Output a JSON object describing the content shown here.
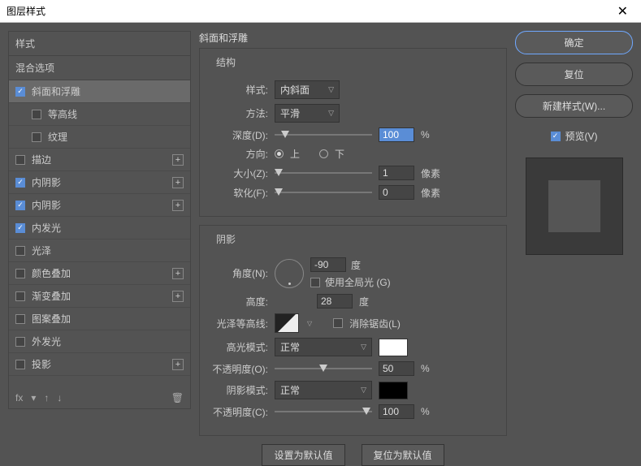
{
  "window": {
    "title": "图层样式"
  },
  "sidebar": {
    "header": "样式",
    "blend": "混合选项",
    "items": [
      {
        "label": "斜面和浮雕",
        "checked": true,
        "selected": true,
        "plus": false,
        "indent": false
      },
      {
        "label": "等高线",
        "checked": false,
        "selected": false,
        "plus": false,
        "indent": true
      },
      {
        "label": "纹理",
        "checked": false,
        "selected": false,
        "plus": false,
        "indent": true
      },
      {
        "label": "描边",
        "checked": false,
        "selected": false,
        "plus": true,
        "indent": false
      },
      {
        "label": "内阴影",
        "checked": true,
        "selected": false,
        "plus": true,
        "indent": false
      },
      {
        "label": "内阴影",
        "checked": true,
        "selected": false,
        "plus": true,
        "indent": false
      },
      {
        "label": "内发光",
        "checked": true,
        "selected": false,
        "plus": false,
        "indent": false
      },
      {
        "label": "光泽",
        "checked": false,
        "selected": false,
        "plus": false,
        "indent": false
      },
      {
        "label": "颜色叠加",
        "checked": false,
        "selected": false,
        "plus": true,
        "indent": false
      },
      {
        "label": "渐变叠加",
        "checked": false,
        "selected": false,
        "plus": true,
        "indent": false
      },
      {
        "label": "图案叠加",
        "checked": false,
        "selected": false,
        "plus": false,
        "indent": false
      },
      {
        "label": "外发光",
        "checked": false,
        "selected": false,
        "plus": false,
        "indent": false
      },
      {
        "label": "投影",
        "checked": false,
        "selected": false,
        "plus": true,
        "indent": false
      }
    ],
    "footer": {
      "fx": "fx"
    }
  },
  "panel": {
    "title": "斜面和浮雕",
    "structure": {
      "title": "结构",
      "style_lbl": "样式:",
      "style_val": "内斜面",
      "method_lbl": "方法:",
      "method_val": "平滑",
      "depth_lbl": "深度(D):",
      "depth_val": "100",
      "depth_unit": "%",
      "dir_lbl": "方向:",
      "dir_up": "上",
      "dir_down": "下",
      "size_lbl": "大小(Z):",
      "size_val": "1",
      "size_unit": "像素",
      "soften_lbl": "软化(F):",
      "soften_val": "0",
      "soften_unit": "像素"
    },
    "shading": {
      "title": "阴影",
      "angle_lbl": "角度(N):",
      "angle_val": "-90",
      "angle_unit": "度",
      "global_lbl": "使用全局光 (G)",
      "alt_lbl": "高度:",
      "alt_val": "28",
      "alt_unit": "度",
      "gloss_lbl": "光泽等高线:",
      "antialias_lbl": "消除锯齿(L)",
      "hmode_lbl": "高光模式:",
      "hmode_val": "正常",
      "hopacity_lbl": "不透明度(O):",
      "hopacity_val": "50",
      "hopacity_unit": "%",
      "smode_lbl": "阴影模式:",
      "smode_val": "正常",
      "sopacity_lbl": "不透明度(C):",
      "sopacity_val": "100",
      "sopacity_unit": "%"
    },
    "buttons": {
      "default": "设置为默认值",
      "reset": "复位为默认值"
    }
  },
  "right": {
    "ok": "确定",
    "cancel": "复位",
    "newstyle": "新建样式(W)...",
    "preview": "预览(V)"
  }
}
